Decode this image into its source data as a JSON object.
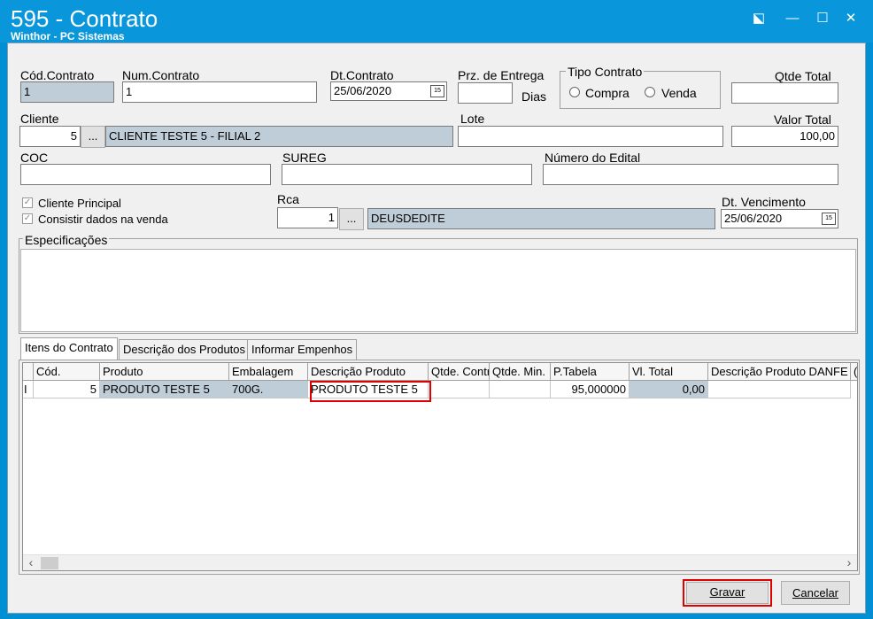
{
  "window": {
    "title": "595 - Contrato",
    "subtitle": "Winthor - PC Sistemas",
    "minimize_glyph": "—",
    "maximize_glyph": "☐",
    "close_glyph": "✕",
    "restore_glyph": "⬕"
  },
  "form": {
    "cod_contrato": {
      "label": "Cód.Contrato",
      "value": "1"
    },
    "num_contrato": {
      "label": "Num.Contrato",
      "value": "1"
    },
    "dt_contrato": {
      "label": "Dt.Contrato",
      "value": "25/06/2020"
    },
    "prz_entrega": {
      "label": "Prz. de Entrega",
      "value": "",
      "unit": "Dias"
    },
    "tipo_contrato": {
      "label": "Tipo Contrato",
      "options": [
        "Compra",
        "Venda"
      ]
    },
    "qtde_total": {
      "label": "Qtde Total",
      "value": ""
    },
    "cliente": {
      "label": "Cliente",
      "code": "5",
      "name": "CLIENTE TESTE 5  - FILIAL 2",
      "lookup": "..."
    },
    "lote": {
      "label": "Lote",
      "value": ""
    },
    "valor_total": {
      "label": "Valor Total",
      "value": "100,00"
    },
    "coc": {
      "label": "COC",
      "value": ""
    },
    "sureg": {
      "label": "SUREG",
      "value": ""
    },
    "numero_edital": {
      "label": "Número do Edital",
      "value": ""
    },
    "cliente_principal": {
      "label": "Cliente Principal",
      "checked": true
    },
    "consistir_dados": {
      "label": "Consistir dados na venda",
      "checked": true
    },
    "rca": {
      "label": "Rca",
      "code": "1",
      "name": "DEUSDEDITE",
      "lookup": "..."
    },
    "dt_vencimento": {
      "label": "Dt. Vencimento",
      "value": "25/06/2020"
    },
    "especificacoes": {
      "label": "Especificações",
      "value": ""
    }
  },
  "calendar_glyph": "15",
  "tabs": [
    {
      "label": "Itens do Contrato",
      "active": true
    },
    {
      "label": "Descrição dos Produtos",
      "active": false
    },
    {
      "label": "Informar Empenhos",
      "active": false
    }
  ],
  "grid": {
    "columns": [
      "Cód.",
      "Produto",
      "Embalagem",
      "Descrição Produto",
      "Qtde. Contr",
      "Qtde. Min.",
      "P.Tabela",
      "Vl. Total",
      "Descrição Produto DANFE",
      "("
    ],
    "rows": [
      {
        "indicator": "I",
        "cod": "5",
        "produto": "PRODUTO TESTE 5",
        "embalagem": "700G.",
        "descricao": "PRODUTO TESTE 5",
        "qtde_contr": "",
        "qtde_min": "",
        "p_tabela": "95,000000",
        "vl_total": "0,00",
        "descricao_danfe": ""
      }
    ]
  },
  "scroll": {
    "left": "‹",
    "right": "›"
  },
  "buttons": {
    "gravar": "Gravar",
    "cancelar": "Cancelar"
  },
  "colors": {
    "title_bar": "#0a96da",
    "highlight": "#e00000",
    "readonly_fill": "#bfcdd8"
  }
}
